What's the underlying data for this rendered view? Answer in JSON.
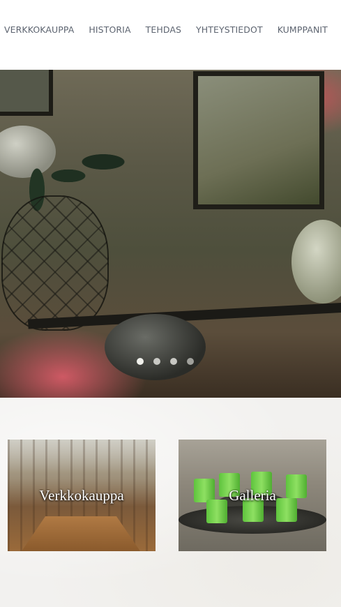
{
  "nav": {
    "items": [
      {
        "label": "VERKKOKAUPPA"
      },
      {
        "label": "HISTORIA"
      },
      {
        "label": "TEHDAS"
      },
      {
        "label": "YHTEYSTIEDOT"
      },
      {
        "label": "KUMPPANIT"
      }
    ]
  },
  "slider": {
    "slide_count": 4,
    "active_index": 0
  },
  "cards": {
    "shop": {
      "label": "Verkkokauppa"
    },
    "gallery": {
      "label": "Galleria"
    }
  },
  "colors": {
    "nav_text": "#5d6470",
    "background": "#f2f1ef",
    "card_label": "#ffffff"
  }
}
